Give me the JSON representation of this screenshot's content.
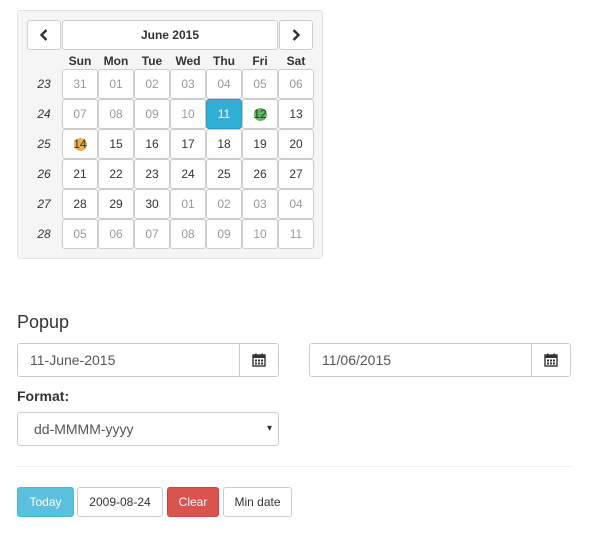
{
  "calendar": {
    "month_title": "June 2015",
    "prev_icon": "chevron-left-icon",
    "next_icon": "chevron-right-icon",
    "weekdays": [
      "Sun",
      "Mon",
      "Tue",
      "Wed",
      "Thu",
      "Fri",
      "Sat"
    ],
    "weeks": [
      {
        "num": "23",
        "days": [
          {
            "label": "31",
            "muted": true
          },
          {
            "label": "01",
            "muted": true
          },
          {
            "label": "02",
            "muted": true
          },
          {
            "label": "03",
            "muted": true
          },
          {
            "label": "04",
            "muted": true
          },
          {
            "label": "05",
            "muted": true
          },
          {
            "label": "06",
            "muted": true
          }
        ]
      },
      {
        "num": "24",
        "days": [
          {
            "label": "07",
            "muted": true
          },
          {
            "label": "08",
            "muted": true
          },
          {
            "label": "09",
            "muted": true
          },
          {
            "label": "10",
            "muted": true
          },
          {
            "label": "11",
            "selected": true
          },
          {
            "label": "12",
            "dot": "#5cb85c"
          },
          {
            "label": "13"
          }
        ]
      },
      {
        "num": "25",
        "days": [
          {
            "label": "14",
            "dot": "#f0ad4e"
          },
          {
            "label": "15"
          },
          {
            "label": "16"
          },
          {
            "label": "17"
          },
          {
            "label": "18"
          },
          {
            "label": "19"
          },
          {
            "label": "20"
          }
        ]
      },
      {
        "num": "26",
        "days": [
          {
            "label": "21"
          },
          {
            "label": "22"
          },
          {
            "label": "23"
          },
          {
            "label": "24"
          },
          {
            "label": "25"
          },
          {
            "label": "26"
          },
          {
            "label": "27"
          }
        ]
      },
      {
        "num": "27",
        "days": [
          {
            "label": "28"
          },
          {
            "label": "29"
          },
          {
            "label": "30"
          },
          {
            "label": "01",
            "muted": true
          },
          {
            "label": "02",
            "muted": true
          },
          {
            "label": "03",
            "muted": true
          },
          {
            "label": "04",
            "muted": true
          }
        ]
      },
      {
        "num": "28",
        "days": [
          {
            "label": "05",
            "muted": true
          },
          {
            "label": "06",
            "muted": true
          },
          {
            "label": "07",
            "muted": true
          },
          {
            "label": "08",
            "muted": true
          },
          {
            "label": "09",
            "muted": true
          },
          {
            "label": "10",
            "muted": true
          },
          {
            "label": "11",
            "muted": true
          }
        ]
      }
    ]
  },
  "popup": {
    "heading": "Popup",
    "input1_value": "11-June-2015",
    "input2_value": "11/06/2015",
    "calendar_icon": "calendar-icon",
    "format_label": "Format:",
    "format_selected": "dd-MMMM-yyyy",
    "caret": "▾"
  },
  "buttons": {
    "today": "Today",
    "date": "2009-08-24",
    "clear": "Clear",
    "min_date": "Min date"
  },
  "colors": {
    "selected": "#31b0d5",
    "info": "#5bc0de",
    "danger": "#d9534f",
    "success_dot": "#5cb85c",
    "warning_dot": "#f0ad4e"
  }
}
